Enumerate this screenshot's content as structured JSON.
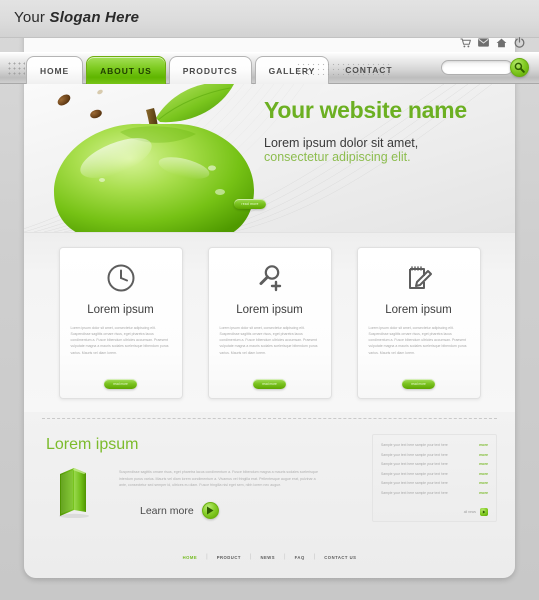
{
  "topbar": {
    "slogan_prefix": "Your ",
    "slogan_strong": "Slogan Here"
  },
  "util_icons": [
    {
      "name": "cart-icon",
      "label": "Cart"
    },
    {
      "name": "mail-icon",
      "label": "Mail"
    },
    {
      "name": "home-icon",
      "label": "Home"
    },
    {
      "name": "power-icon",
      "label": "Power"
    }
  ],
  "nav": {
    "tabs": [
      {
        "label": "HOME",
        "active": false
      },
      {
        "label": "ABOUT US",
        "active": true
      },
      {
        "label": "PRODUTCS",
        "active": false
      },
      {
        "label": "GALLERY",
        "active": false
      }
    ],
    "flat_tab": "CONTACT",
    "search": {
      "value": "",
      "placeholder": "",
      "button_icon": "search-icon"
    }
  },
  "hero": {
    "title": "Your website name",
    "subtitle_line1": "Lorem ipsum dolor sit amet,",
    "subtitle_line2": "consectetur adipiscing elit.",
    "button_label": "read more",
    "image": "green-apple"
  },
  "cards": [
    {
      "icon": "clock-icon",
      "title": "Lorem ipsum",
      "body": "Lorem ipsum dolor sit amet, consectetur adipiscing elit. Suspendisse sagittis ornare risus, eget pharetra lacus condimentum a. Fusce bibendum ultricies accumsan. Praesent vulputate magna a mauris sodales scelerisque bibendum purus varius. Mauris vel diam lorem.",
      "button_label": "read more"
    },
    {
      "icon": "zoom-in-icon",
      "title": "Lorem ipsum",
      "body": "Lorem ipsum dolor sit amet, consectetur adipiscing elit. Suspendisse sagittis ornare risus, eget pharetra lacus condimentum a. Fusce bibendum ultricies accumsan. Praesent vulputate magna a mauris sodales scelerisque bibendum purus varius. Mauris vel diam lorem.",
      "button_label": "read more"
    },
    {
      "icon": "notepad-pencil-icon",
      "title": "Lorem ipsum",
      "body": "Lorem ipsum dolor sit amet, consectetur adipiscing elit. Suspendisse sagittis ornare risus, eget pharetra lacus condimentum a. Fusce bibendum ultricies accumsan. Praesent vulputate magna a mauris sodales scelerisque bibendum purus varius. Mauris vel diam lorem.",
      "button_label": "read more"
    }
  ],
  "lower": {
    "title": "Lorem ipsum",
    "image": "green-book",
    "body": "Suspendisse sagittis ornare risus, eget pharetra lacus condimentum a. Fusce bibendum magna a mauris sodales scelerisque interdum purus varius. Mauris vel diam lorem condimentum a. Vivamus vel fringilla erat. Pellentesque augue erat, pulvinar a ante, consectetur sed semper id, ultrices eu diam. Fusce fringilla nisl eget sem, nibh lorem nec augue.",
    "learn_more_label": "Learn more",
    "play_icon": "play-icon"
  },
  "news": {
    "rows": [
      {
        "text": "Sample your text here sample your text here",
        "more": "more"
      },
      {
        "text": "Sample your text here sample your text here",
        "more": "more"
      },
      {
        "text": "Sample your text here sample your text here",
        "more": "more"
      },
      {
        "text": "Sample your text here sample your text here",
        "more": "more"
      },
      {
        "text": "Sample your text here sample your text here",
        "more": "more"
      },
      {
        "text": "Sample your text here sample your text here",
        "more": "more"
      }
    ],
    "all_news_label": "all news"
  },
  "footer": {
    "links": [
      {
        "label": "HOME",
        "active": true
      },
      {
        "label": "PRODUCT",
        "active": false
      },
      {
        "label": "NEWS",
        "active": false
      },
      {
        "label": "FAQ",
        "active": false
      },
      {
        "label": "CONTACT US",
        "active": false
      }
    ],
    "separator": "|"
  },
  "colors": {
    "brand_green": "#7cbb2c",
    "title_green": "#6cb022",
    "sub_green": "#8dbd4f",
    "page_bg": "#d2d2d2"
  }
}
